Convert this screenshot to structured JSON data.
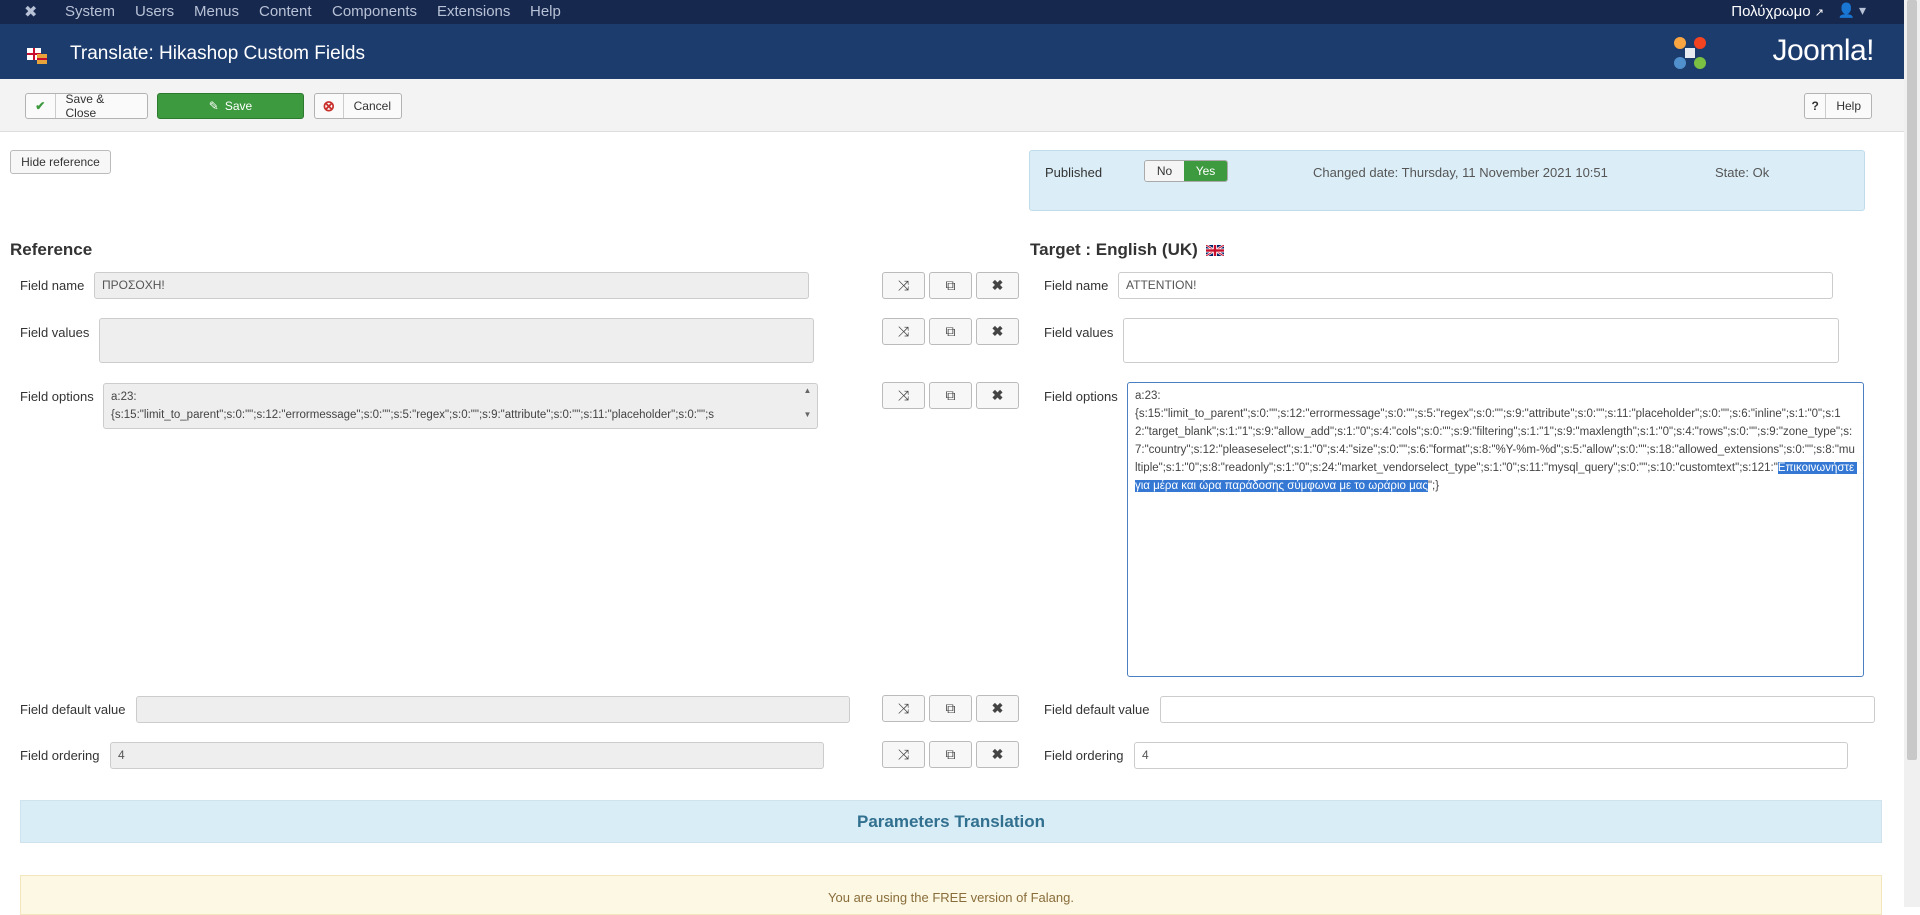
{
  "topnav": {
    "menu": [
      "System",
      "Users",
      "Menus",
      "Content",
      "Components",
      "Extensions",
      "Help"
    ],
    "site_label": "Πολύχρωμο",
    "user_icon": "user-icon"
  },
  "header": {
    "title": "Translate: Hikashop Custom Fields",
    "logo_text": "Joomla!"
  },
  "toolbar": {
    "save_close": "Save & Close",
    "save": "Save",
    "cancel": "Cancel",
    "help": "Help"
  },
  "hide_reference": "Hide reference",
  "status": {
    "published_label": "Published",
    "no": "No",
    "yes": "Yes",
    "changed_date": "Changed date: Thursday, 11 November 2021 10:51",
    "state": "State: Ok"
  },
  "reference": {
    "heading": "Reference",
    "field_name_label": "Field name",
    "field_name_value": "ΠΡΟΣΟΧΗ!",
    "field_values_label": "Field values",
    "field_values_value": "",
    "field_options_label": "Field options",
    "field_options_value": "a:23:\n{s:15:\"limit_to_parent\";s:0:\"\";s:12:\"errormessage\";s:0:\"\";s:5:\"regex\";s:0:\"\";s:9:\"attribute\";s:0:\"\";s:11:\"placeholder\";s:0:\"\";s",
    "field_default_label": "Field default value",
    "field_default_value": "",
    "field_ordering_label": "Field ordering",
    "field_ordering_value": "4"
  },
  "target": {
    "heading": "Target : English (UK)",
    "field_name_label": "Field name",
    "field_name_value": "ATTENTION!",
    "field_values_label": "Field values",
    "field_values_value": "",
    "field_options_label": "Field options",
    "field_options_value": "a:23:\n{s:15:\"limit_to_parent\";s:0:\"\";s:12:\"errormessage\";s:0:\"\";s:5:\"regex\";s:0:\"\";s:9:\"attribute\";s:0:\"\";s:11:\"placeholder\";s:0:\"\";s:6:\"inline\";s:1:\"0\";s:12:\"target_blank\";s:1:\"1\";s:9:\"allow_add\";s:1:\"0\";s:4:\"cols\";s:0:\"\";s:9:\"filtering\";s:1:\"1\";s:9:\"maxlength\";s:1:\"0\";s:4:\"rows\";s:0:\"\";s:9:\"zone_type\";s:7:\"country\";s:12:\"pleaseselect\";s:1:\"0\";s:4:\"size\";s:0:\"\";s:6:\"format\";s:8:\"%Y-%m-%d\";s:5:\"allow\";s:0:\"\";s:18:\"allowed_extensions\";s:0:\"\";s:8:\"multiple\";s:1:\"0\";s:8:\"readonly\";s:1:\"0\";s:24:\"market_vendorselect_type\";s:1:\"0\";s:11:\"mysql_query\";s:0:\"\";s:10:\"customtext\";s:121:\"",
    "field_options_selected": "Επικοινωνήστε για μέρα και ώρα παράδοσης σύμφωνα με το ωράριο μας",
    "field_options_tail": "\";}",
    "field_default_label": "Field default value",
    "field_default_value": "",
    "field_ordering_label": "Field ordering",
    "field_ordering_value": "4"
  },
  "params_heading": "Parameters Translation",
  "free_notice": "You are using the FREE version of Falang.",
  "colors": {
    "topnav_bg": "#17284f",
    "header_bg": "#1d3c6e",
    "save_green": "#3d9a3f",
    "published_yes": "#3d9a3f",
    "selection": "#3478d4"
  }
}
